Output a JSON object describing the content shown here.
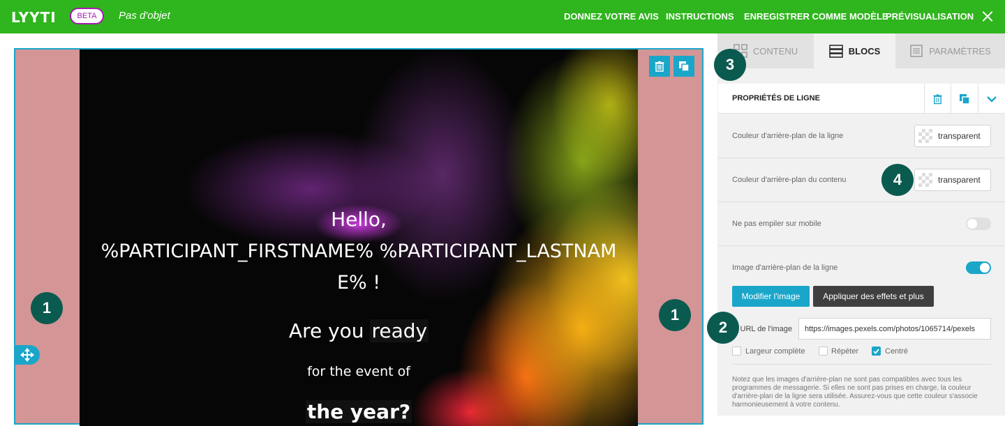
{
  "header": {
    "logo": "LYYTI",
    "beta": "BETA",
    "subject": "Pas d'objet",
    "nav": [
      "DONNEZ VOTRE AVIS",
      "INSTRUCTIONS",
      "ENREGISTRER COMME MODÈLE",
      "PRÉVISUALISATION"
    ]
  },
  "hero": {
    "line1": "Hello,",
    "line2": "%PARTICIPANT_FIRSTNAME% %PARTICIPANT_LASTNAM",
    "line3": "E% !",
    "line4_a": "Are you ",
    "line4_b": "ready",
    "line5": "for the event of",
    "line6": "the year?"
  },
  "badges": [
    "1",
    "1",
    "2",
    "3",
    "4"
  ],
  "tabs": [
    "CONTENU",
    "BLOCS",
    "PARAMÈTRES"
  ],
  "section": {
    "title": "PROPRIÉTÉS DE LIGNE"
  },
  "properties": {
    "row_bg_label": "Couleur d'arrière-plan de la ligne",
    "row_bg_value": "transparent",
    "content_bg_label": "Couleur d'arrière-plan du contenu",
    "content_bg_value": "transparent",
    "no_stack_label": "Ne pas empiler sur mobile",
    "bg_image_label": "Image d'arrière-plan de la ligne",
    "edit_image_button": "Modifier l'image",
    "effects_button": "Appliquer des effets et plus",
    "url_label": "URL de l'image",
    "url_value": "https://images.pexels.com/photos/1065714/pexels",
    "full_width_label": "Largeur complète",
    "repeat_label": "Répéter",
    "centered_label": "Centré",
    "note": "Notez que les images d'arrière-plan ne sont pas compatibles avec tous les programmes de messagerie. Si elles ne sont pas prises en charge, la couleur d'arrière-plan de la ligne sera utilisée. Assurez-vous que cette couleur s'associe harmonieusement à votre contenu."
  },
  "colors": {
    "header": "#2fb51d",
    "accent": "#1aa6c9",
    "badge": "#0b5a4f",
    "row_bg": "#d39596",
    "beta": "#a21caf"
  }
}
